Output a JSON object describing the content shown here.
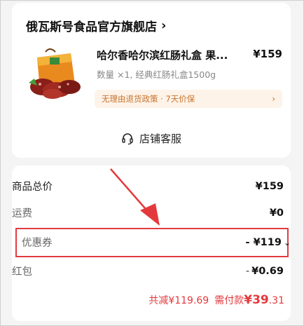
{
  "shop": {
    "name": "俄瓦斯号食品官方旗舰店",
    "chevron": "›",
    "product": {
      "title": "哈尔香哈尔滨红肠礼盒 果...",
      "price": "¥159",
      "spec": "数量 ×1, 经典红肠礼盒1500g",
      "policy": "无理由退货政策 · 7天价保",
      "policy_chevron": "›"
    },
    "service_label": "店铺客服"
  },
  "fees": {
    "items": [
      {
        "label": "商品总价",
        "value": "¥159"
      },
      {
        "label": "运费",
        "value": "¥0"
      },
      {
        "label": "优惠券",
        "value": "- ¥119",
        "chevron": "⌄"
      },
      {
        "label": "红包",
        "value_prefix": "- ",
        "value": "¥0.69"
      }
    ],
    "total": {
      "discount_label": "共减",
      "discount_value": "¥119.69",
      "pay_label": "需付款",
      "pay_currency": "¥",
      "pay_int": "39",
      "pay_dec": ".31"
    }
  },
  "colors": {
    "accent_red": "#e4393c",
    "highlight_border": "#e23b40",
    "policy_bg": "#fdf3e8",
    "policy_text": "#c8732e"
  },
  "icons": {
    "service": "headset-icon",
    "shop_chevron": "chevron-right-icon",
    "coupon_chevron": "chevron-down-icon"
  }
}
